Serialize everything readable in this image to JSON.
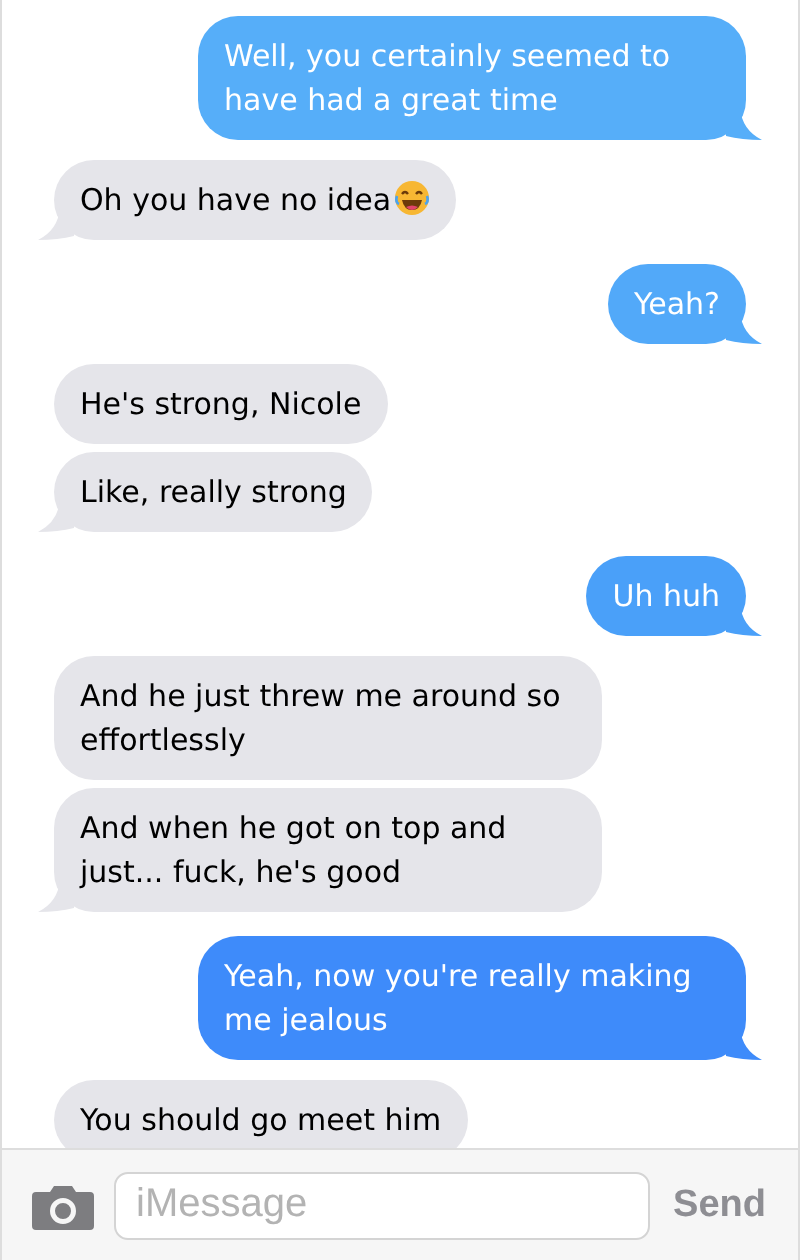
{
  "messages": [
    {
      "kind": "sent",
      "text": "Well, you certainly seemed to have had a great time",
      "tail": true,
      "color": "#56aef9"
    },
    {
      "kind": "received",
      "text": "Oh you have no idea",
      "emoji": true,
      "tail": true
    },
    {
      "kind": "sent",
      "text": "Yeah?",
      "tail": true,
      "color": "#52a9f9"
    },
    {
      "kind": "received",
      "text": "He's strong, Nicole",
      "tail": false
    },
    {
      "kind": "received",
      "text": "Like, really strong",
      "tail": true
    },
    {
      "kind": "sent",
      "text": "Uh huh",
      "tail": true,
      "color": "#4aa0f9"
    },
    {
      "kind": "received",
      "text": "And he just threw me around so effortlessly",
      "tail": false
    },
    {
      "kind": "received",
      "text": "And when he got on top and just... fuck, he's good",
      "tail": true
    },
    {
      "kind": "sent",
      "text": "Yeah, now you're really making me jealous",
      "tail": true,
      "color": "#3e8bfa"
    },
    {
      "kind": "received",
      "text": "You should go meet him",
      "tail": false
    }
  ],
  "composer": {
    "placeholder": "iMessage",
    "send": "Send"
  }
}
